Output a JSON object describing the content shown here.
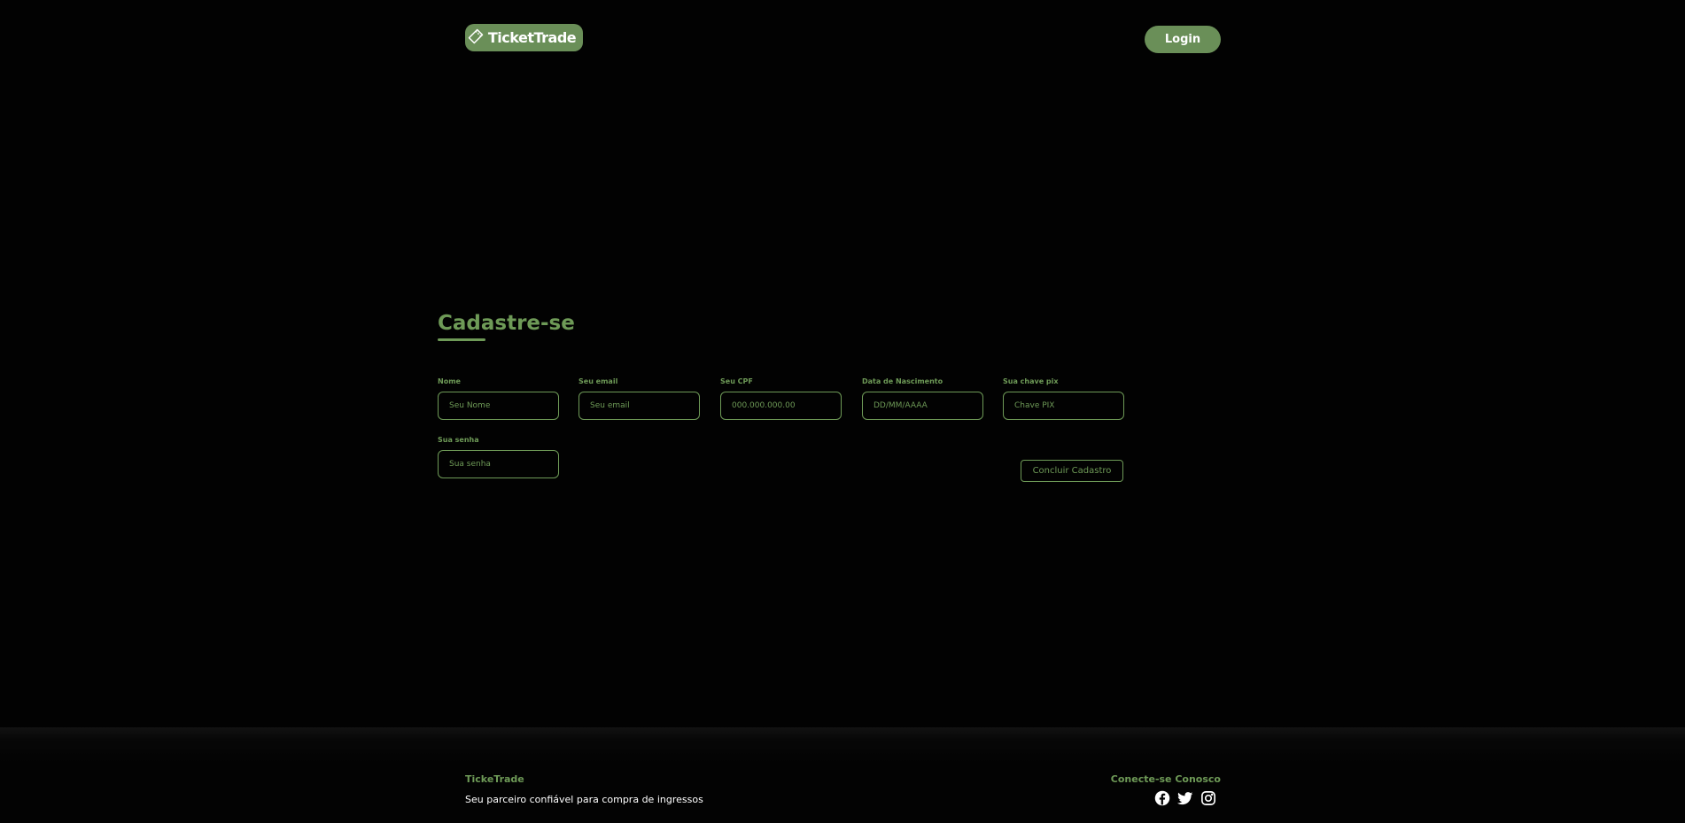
{
  "header": {
    "logo_text": "TicketTrade",
    "login_label": "Login"
  },
  "form": {
    "title": "Cadastre-se",
    "fields": [
      {
        "label": "Nome",
        "placeholder": "Seu Nome"
      },
      {
        "label": "Seu email",
        "placeholder": "Seu email"
      },
      {
        "label": "Seu CPF",
        "placeholder": "000.000.000.00"
      },
      {
        "label": "Data de Nascimento",
        "placeholder": "DD/MM/AAAA"
      },
      {
        "label": "Sua chave pix",
        "placeholder": "Chave PIX"
      },
      {
        "label": "Sua senha",
        "placeholder": "Sua senha"
      }
    ],
    "submit_label": "Concluir Cadastro"
  },
  "footer": {
    "brand": "TickeTrade",
    "tagline": "Seu parceiro confiável para compra de ingressos",
    "connect_title": "Conecte-se Conosco",
    "social": [
      "facebook-icon",
      "twitter-icon",
      "instagram-icon"
    ]
  },
  "colors": {
    "background": "#020202",
    "accent": "#6e9a57",
    "button_bg": "#6a8f58",
    "text_light": "#ffffff"
  }
}
